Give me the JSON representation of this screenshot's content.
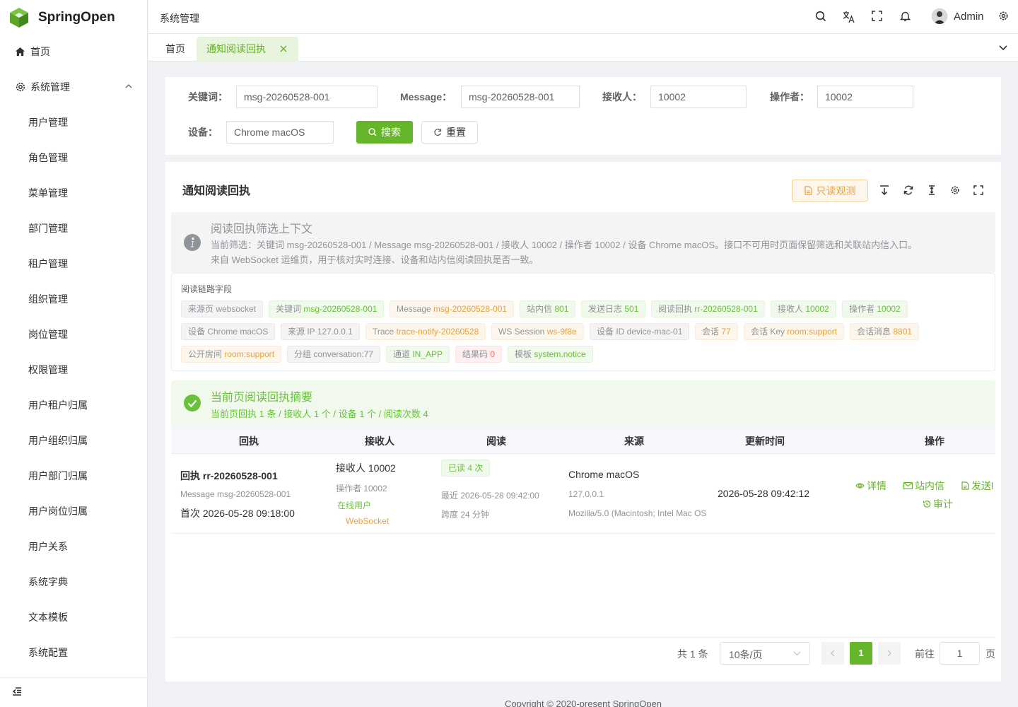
{
  "app": {
    "name": "SpringOpen"
  },
  "sidebar": {
    "home_label": "首页",
    "group_label": "系统管理",
    "items": [
      "用户管理",
      "角色管理",
      "菜单管理",
      "部门管理",
      "租户管理",
      "组织管理",
      "岗位管理",
      "权限管理",
      "用户租户归属",
      "用户组织归属",
      "用户部门归属",
      "用户岗位归属",
      "用户关系",
      "系统字典",
      "文本模板",
      "系统配置"
    ]
  },
  "header": {
    "breadcrumb": "系统管理",
    "user_name": "Admin"
  },
  "tabs": {
    "home": "首页",
    "active": "通知阅读回执"
  },
  "search": {
    "keyword_label": "关键词：",
    "keyword_value": "msg-20260528-001",
    "message_label": "Message：",
    "message_value": "msg-20260528-001",
    "receiver_label": "接收人：",
    "receiver_value": "10002",
    "operator_label": "操作者：",
    "operator_value": "10002",
    "device_label": "设备：",
    "device_value": "Chrome macOS",
    "search_btn": "搜索",
    "reset_btn": "重置"
  },
  "card": {
    "title": "通知阅读回执",
    "readonly_btn": "只读观测",
    "info_title": "阅读回执筛选上下文",
    "info_line1": "当前筛选：关键词 msg-20260528-001 / Message msg-20260528-001 / 接收人 10002 / 操作者 10002 / 设备 Chrome macOS。接口不可用时页面保留筛选和关联站内信入口。",
    "info_line2": "来自 WebSocket 运维页，用于核对实时连接、设备和站内信阅读回执是否一致。",
    "fields_title": "阅读链路字段",
    "tags": [
      {
        "k": "来源页 ",
        "v": "websocket",
        "type": "info"
      },
      {
        "k": "关键词 ",
        "v": "msg-20260528-001",
        "type": "success"
      },
      {
        "k": "Message ",
        "v": "msg-20260528-001",
        "type": "warning"
      },
      {
        "k": "站内信 ",
        "v": "801",
        "type": "success"
      },
      {
        "k": "发送日志 ",
        "v": "501",
        "type": "success"
      },
      {
        "k": "阅读回执 ",
        "v": "rr-20260528-001",
        "type": "success"
      },
      {
        "k": "接收人 ",
        "v": "10002",
        "type": "success"
      },
      {
        "k": "操作者 ",
        "v": "10002",
        "type": "success"
      },
      {
        "k": "设备 ",
        "v": "Chrome macOS",
        "type": "info"
      },
      {
        "k": "来源 IP ",
        "v": "127.0.0.1",
        "type": "info"
      },
      {
        "k": "Trace ",
        "v": "trace-notify-20260528",
        "type": "warning"
      },
      {
        "k": "WS Session ",
        "v": "ws-9f8e",
        "type": "warning"
      },
      {
        "k": "设备 ID ",
        "v": "device-mac-01",
        "type": "info"
      },
      {
        "k": "会话 ",
        "v": "77",
        "type": "warning"
      },
      {
        "k": "会话 Key ",
        "v": "room:support",
        "type": "warning"
      },
      {
        "k": "会话消息 ",
        "v": "8801",
        "type": "warning"
      },
      {
        "k": "公开房间 ",
        "v": "room:support",
        "type": "warning"
      },
      {
        "k": "分组 ",
        "v": "conversation:77",
        "type": "info"
      },
      {
        "k": "通道 ",
        "v": "IN_APP",
        "type": "success"
      },
      {
        "k": "结果码 ",
        "v": "0",
        "type": "danger"
      },
      {
        "k": "模板 ",
        "v": "system.notice",
        "type": "success"
      }
    ],
    "summary_title": "当前页阅读回执摘要",
    "summary_desc": "当前页回执 1 条 / 接收人 1 个 / 设备 1 个 / 阅读次数 4"
  },
  "table": {
    "headers": [
      "回执",
      "接收人",
      "阅读",
      "来源",
      "更新时间",
      "操作"
    ],
    "row": {
      "receipt_id": "回执 rr-20260528-001",
      "message": "Message msg-20260528-001",
      "first": "首次 2026-05-28 09:18:00",
      "receiver": "接收人 10002",
      "operator": "操作者 10002",
      "online": "在线用户",
      "websocket": "WebSocket",
      "read_tag": "已读 4 次",
      "recent": "最近 2026-05-28 09:42:00",
      "span": "跨度 24 分钟",
      "device": "Chrome macOS",
      "ip": "127.0.0.1",
      "ua": "Mozilla/5.0 (Macintosh; Intel Mac OS",
      "updated": "2026-05-28 09:42:12",
      "act_detail": "详情",
      "act_inbox": "站内信",
      "act_send": "发送l",
      "act_audit": "审计"
    }
  },
  "pagination": {
    "total": "共 1 条",
    "page_size": "10条/页",
    "current": "1",
    "goto": "前往",
    "goto_value": "1",
    "page_unit": "页"
  },
  "footer": {
    "text": "Copyright © 2020-present SpringOpen"
  },
  "colors": {
    "primary": "#67b52a",
    "warning": "#e6a23c",
    "success": "#67c23a",
    "danger": "#f56c6c",
    "info": "#909399"
  }
}
